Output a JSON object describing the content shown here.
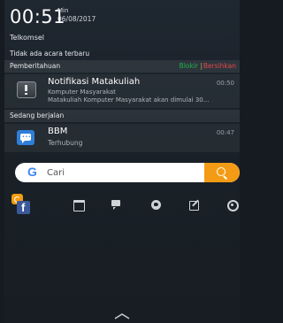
{
  "status": {
    "time": "00:51",
    "day": "Min",
    "date": "06/08/2017",
    "carrier": "Telkomsel"
  },
  "events": {
    "none_text": "Tidak ada acara terbaru"
  },
  "notifications_section": {
    "title": "Pemberitahuan",
    "block_label": "Blokir",
    "separator": "|",
    "clear_label": "Bersihkan",
    "items": [
      {
        "app_icon": "alert-icon",
        "title": "Notifikasi Matakuliah",
        "subtitle": "Komputer Masyarakat",
        "body": "Matakuliah Komputer Masyarakat akan dimulai 30...",
        "time": "00:50"
      }
    ]
  },
  "ongoing_section": {
    "title": "Sedang berjalan",
    "items": [
      {
        "app_icon": "bbm-icon",
        "title": "BBM",
        "subtitle": "Terhubung",
        "time": "00:47"
      }
    ]
  },
  "search": {
    "logo": "G",
    "placeholder": "Cari",
    "button_icon": "search-icon"
  },
  "quick_icons": [
    "facebook-icon",
    "window-icon",
    "chat-icon",
    "globe-icon",
    "edit-icon",
    "settings-icon"
  ],
  "colors": {
    "block": "#22b14c",
    "clear": "#e04848",
    "search_button": "#f49b15",
    "bbm": "#2f7fd8"
  }
}
